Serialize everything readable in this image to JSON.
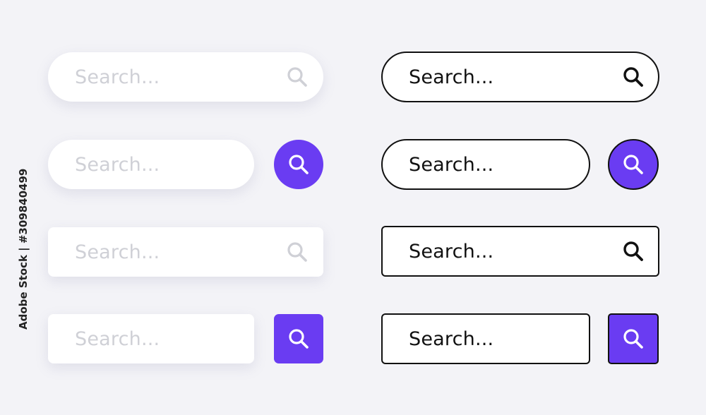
{
  "placeholder": "Search...",
  "watermark": "Adobe Stock | #309840499",
  "colors": {
    "accent": "#6a3cf2",
    "background": "#f3f3f7",
    "soft_placeholder": "#cfd0d6",
    "soft_icon": "#cfd0d6",
    "outline": "#111111"
  },
  "icons": {
    "search": "magnifier-icon"
  },
  "left_column": [
    {
      "style": "soft pill with inner icon",
      "placeholder": "Search..."
    },
    {
      "style": "soft pill with round button",
      "placeholder": "Search..."
    },
    {
      "style": "soft rectangle with inner icon",
      "placeholder": "Search..."
    },
    {
      "style": "soft rectangle with square button",
      "placeholder": "Search..."
    }
  ],
  "right_column": [
    {
      "style": "outlined pill with inner icon",
      "placeholder": "Search..."
    },
    {
      "style": "outlined pill with round button",
      "placeholder": "Search..."
    },
    {
      "style": "outlined rectangle with inner icon",
      "placeholder": "Search..."
    },
    {
      "style": "outlined rectangle with square button",
      "placeholder": "Search..."
    }
  ]
}
